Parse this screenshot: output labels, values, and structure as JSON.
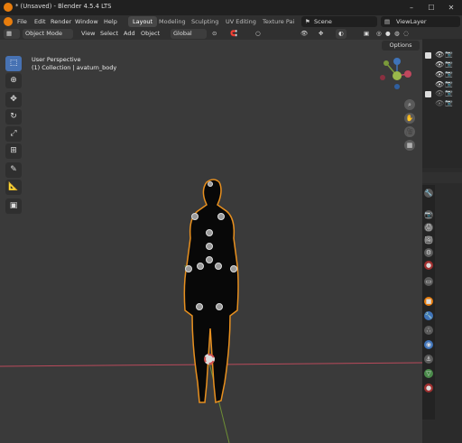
{
  "app": {
    "title": "* (Unsaved) - Blender 4.5.4 LTS"
  },
  "menu": {
    "items": [
      "File",
      "Edit",
      "Render",
      "Window",
      "Help"
    ]
  },
  "workspaces": [
    "Layout",
    "Modeling",
    "Sculpting",
    "UV Editing",
    "Texture Pai"
  ],
  "scene": {
    "label": "Scene",
    "view_layer": "ViewLayer"
  },
  "header": {
    "mode": "Object Mode",
    "view": "View",
    "select": "Select",
    "add": "Add",
    "object": "Object",
    "transform": "Global",
    "options": "Options"
  },
  "overlay": {
    "perspective": "User Perspective",
    "collection": "(1) Collection | avaturn_body"
  },
  "gizmo": {
    "x": "X",
    "y": "Y",
    "z": "Z"
  },
  "colors": {
    "accent": "#4772b3",
    "selection": "#f0a030",
    "x_axis": "#c0485e",
    "y_axis": "#7a9a3a"
  },
  "tools": [
    "cursor-select",
    "cursor",
    "move",
    "rotate",
    "scale",
    "transform",
    "annotate",
    "measure",
    "add-cube"
  ]
}
